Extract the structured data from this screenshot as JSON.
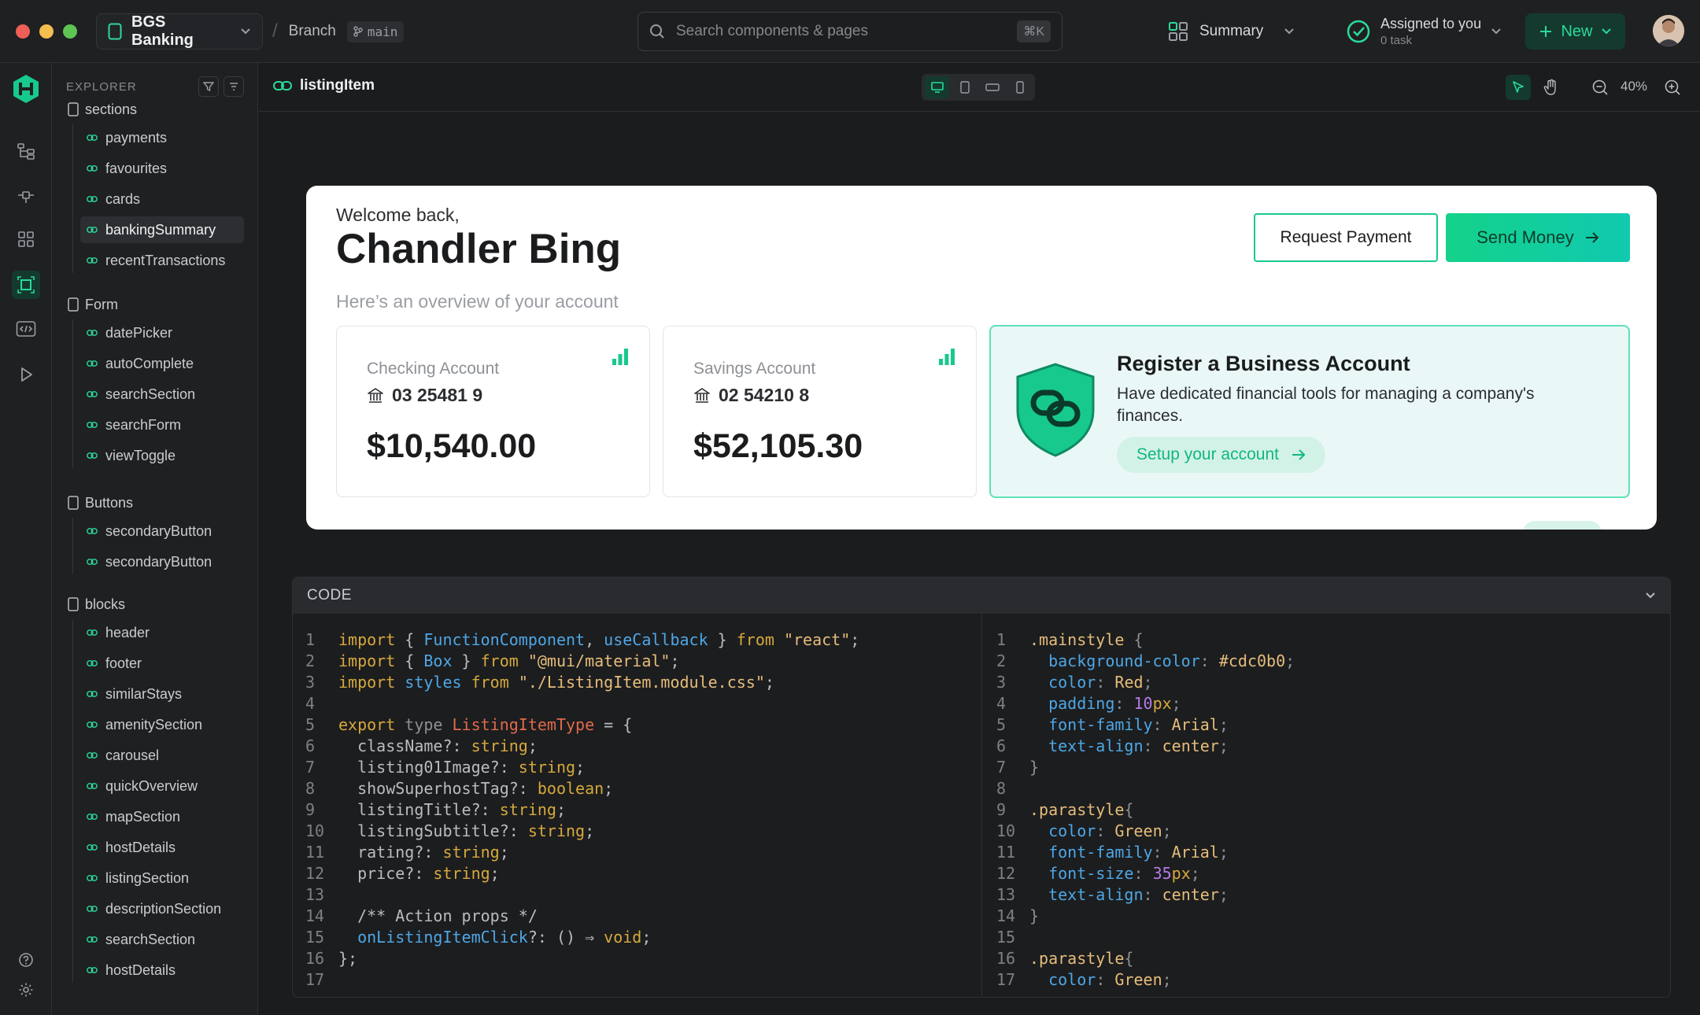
{
  "topbar": {
    "project_name": "BGS Banking",
    "branch_label": "Branch",
    "branch_name": "main",
    "search_placeholder": "Search components & pages",
    "search_shortcut": "⌘K",
    "summary_label": "Summary",
    "assigned_title": "Assigned to you",
    "assigned_count": "0 task",
    "new_label": "New"
  },
  "explorer": {
    "title": "EXPLORER",
    "groups": [
      {
        "name": "sections",
        "items": [
          "payments",
          "favourites",
          "cards",
          "bankingSummary",
          "recentTransactions"
        ]
      },
      {
        "name": "Form",
        "items": [
          "datePicker",
          "autoComplete",
          "searchSection",
          "searchForm",
          "viewToggle"
        ]
      },
      {
        "name": "Buttons",
        "items": [
          "secondaryButton",
          "secondaryButton"
        ]
      },
      {
        "name": "blocks",
        "items": [
          "header",
          "footer",
          "similarStays",
          "amenitySection",
          "carousel",
          "quickOverview",
          "mapSection",
          "hostDetails",
          "listingSection",
          "descriptionSection",
          "searchSection",
          "hostDetails"
        ]
      }
    ],
    "active_item": "bankingSummary"
  },
  "canvas": {
    "component_name": "listingItem",
    "zoom": "40%"
  },
  "preview": {
    "welcome": "Welcome back,",
    "user_name": "Chandler Bing",
    "overview": "Here’s an overview of your account",
    "request_label": "Request Payment",
    "send_label": "Send Money",
    "accounts": [
      {
        "type": "Checking Account",
        "number": "03 25481 9",
        "balance": "$10,540.00"
      },
      {
        "type": "Savings Account",
        "number": "02 54210 8",
        "balance": "$52,105.30"
      }
    ],
    "business": {
      "title": "Register a Business Account",
      "description": "Have dedicated financial tools for managing a company's finances.",
      "cta": "Setup your account"
    },
    "colors": {
      "accent": "#14d28a",
      "accent_dark": "#10b77f"
    }
  },
  "code_panel": {
    "title": "CODE",
    "tsx_lines": [
      "import { FunctionComponent, useCallback } from \"react\";",
      "import { Box } from \"@mui/material\";",
      "import styles from \"./ListingItem.module.css\";",
      "",
      "export type ListingItemType = {",
      "  className?: string;",
      "  listing01Image?: string;",
      "  showSuperhostTag?: boolean;",
      "  listingTitle?: string;",
      "  listingSubtitle?: string;",
      "  rating?: string;",
      "  price?: string;",
      "",
      "  /** Action props */",
      "  onListingItemClick?: () ⇒ void;",
      "};",
      ""
    ],
    "css_lines": [
      ".mainstyle {",
      "  background-color: #cdc0b0;",
      "  color: Red;",
      "  padding: 10px;",
      "  font-family: Arial;",
      "  text-align: center;",
      "}",
      "",
      ".parastyle{",
      "  color: Green;",
      "  font-family: Arial;",
      "  font-size: 35px;",
      "  text-align: center;",
      "}",
      "",
      ".parastyle{",
      "  color: Green;"
    ]
  }
}
